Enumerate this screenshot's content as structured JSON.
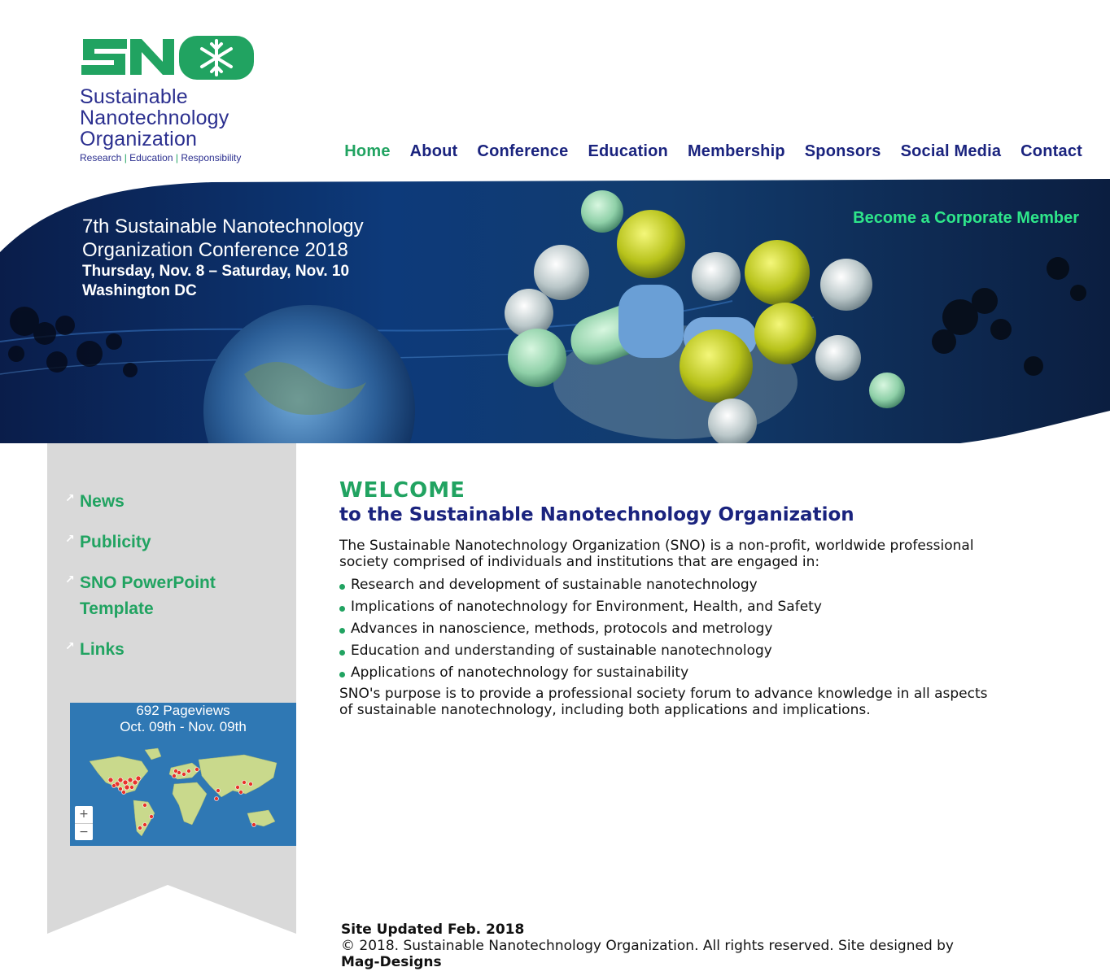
{
  "logo": {
    "name_line1": "Sustainable",
    "name_line2": "Nanotechnology",
    "name_line3": "Organization",
    "tagline_1": "Research",
    "tagline_sep": " | ",
    "tagline_2": "Education",
    "tagline_3": "Responsibility",
    "mark_icon": "snowflake-icon",
    "brand_green": "#21a361",
    "brand_navy": "#2b2f8f"
  },
  "nav": {
    "items": [
      {
        "label": "Home",
        "active": true
      },
      {
        "label": "About"
      },
      {
        "label": "Conference"
      },
      {
        "label": "Education"
      },
      {
        "label": "Membership"
      },
      {
        "label": "Sponsors"
      },
      {
        "label": "Social Media"
      },
      {
        "label": "Contact"
      }
    ],
    "active_color": "#21a361",
    "color": "#1a237e"
  },
  "banner": {
    "title_line1": "7th Sustainable Nanotechnology",
    "title_line2": "Organization Conference 2018",
    "dates": "Thursday, Nov. 8 – Saturday, Nov. 10",
    "location": "Washington DC",
    "corporate_link": "Become a Corporate Member"
  },
  "sidebar": {
    "links": [
      "News",
      "Publicity",
      "SNO PowerPoint Template",
      "Links"
    ],
    "link_icon": "arrow-up-right-icon",
    "map": {
      "pageviews": "692 Pageviews",
      "range": "Oct. 09th - Nov. 09th",
      "zoom_in": "+",
      "zoom_out": "−"
    }
  },
  "main": {
    "heading": "WELCOME",
    "subheading": "to the Sustainable Nanotechnology Organization",
    "intro": "The Sustainable Nanotechnology Organization (SNO) is a non-profit, worldwide professional society comprised of individuals and institutions that are engaged in:",
    "bullets": [
      "Research and development of sustainable nanotechnology",
      "Implications of nanotechnology for Environment, Health, and Safety",
      "Advances in nanoscience, methods, protocols and metrology",
      "Education and understanding of sustainable nanotechnology",
      "Applications of nanotechnology for sustainability"
    ],
    "purpose": "SNO's purpose is to provide a professional society forum to advance knowledge in all aspects of sustainable nanotechnology, including both applications and implications."
  },
  "footer": {
    "updated": "Site Updated Feb. 2018",
    "copyright": "© 2018. Sustainable Nanotechnology Organization. All rights reserved. Site designed by",
    "designer": "Mag-Designs"
  }
}
